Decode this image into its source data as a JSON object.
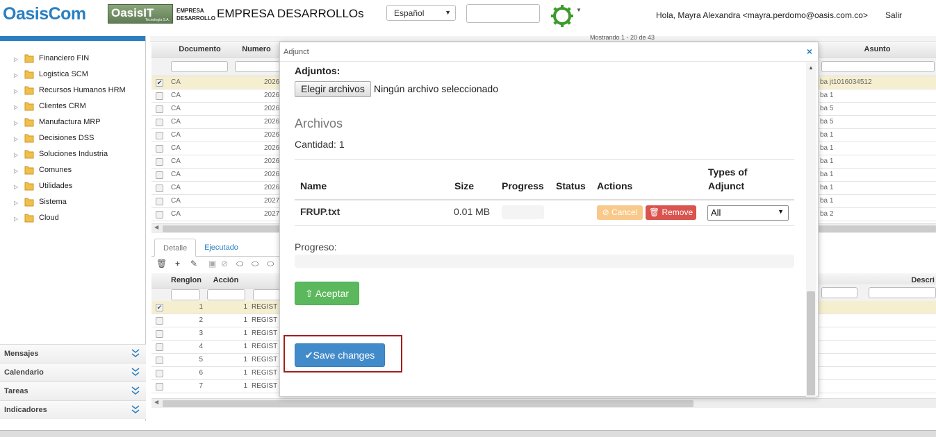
{
  "header": {
    "logo_main": "OasisCom",
    "logo_secondary": "OasisIT",
    "logo_secondary_tag": "Tecnología S.A.",
    "company_small_line1": "EMPRESA",
    "company_small_line2": "DESARROLLO",
    "company_title": "EMPRESA DESARROLLOs",
    "language_selected": "Español",
    "greeting": "Hola, Mayra Alexandra <mayra.perdomo@oasis.com.co>",
    "logout_label": "Salir"
  },
  "sidebar": {
    "items": [
      {
        "label": "Financiero FIN"
      },
      {
        "label": "Logistica SCM"
      },
      {
        "label": "Recursos Humanos HRM"
      },
      {
        "label": "Clientes CRM"
      },
      {
        "label": "Manufactura MRP"
      },
      {
        "label": "Decisiones DSS"
      },
      {
        "label": "Soluciones Industria"
      },
      {
        "label": "Comunes"
      },
      {
        "label": "Utilidades"
      },
      {
        "label": "Sistema"
      },
      {
        "label": "Cloud"
      }
    ],
    "panels": [
      {
        "label": "Mensajes"
      },
      {
        "label": "Calendario"
      },
      {
        "label": "Tareas"
      },
      {
        "label": "Indicadores"
      }
    ]
  },
  "grid": {
    "showing": "Mostrando 1 - 20 de 43",
    "columns": [
      "Documento",
      "Numero",
      "Asunto"
    ],
    "rows": [
      {
        "doc": "CA",
        "num": "2026",
        "asunto": "ba jt1016034512"
      },
      {
        "doc": "CA",
        "num": "2026",
        "asunto": "ba 1"
      },
      {
        "doc": "CA",
        "num": "2026",
        "asunto": "ba 5"
      },
      {
        "doc": "CA",
        "num": "2026",
        "asunto": "ba 5"
      },
      {
        "doc": "CA",
        "num": "2026",
        "asunto": "ba 1"
      },
      {
        "doc": "CA",
        "num": "2026",
        "asunto": "ba 1"
      },
      {
        "doc": "CA",
        "num": "2026",
        "asunto": "ba 1"
      },
      {
        "doc": "CA",
        "num": "2026",
        "asunto": "ba 1"
      },
      {
        "doc": "CA",
        "num": "2026",
        "asunto": "ba 1"
      },
      {
        "doc": "CA",
        "num": "2027",
        "asunto": "ba 1"
      },
      {
        "doc": "CA",
        "num": "2027",
        "asunto": "ba 2"
      }
    ]
  },
  "detail": {
    "tab_detalle": "Detalle",
    "tab_ejecutado": "Ejecutado",
    "columns": [
      "Renglon",
      "Acción",
      "Descri"
    ],
    "rows": [
      {
        "renglon": "1",
        "accion": "1",
        "rest": "REGIST"
      },
      {
        "renglon": "2",
        "accion": "1",
        "rest": "REGIST"
      },
      {
        "renglon": "3",
        "accion": "1",
        "rest": "REGIST"
      },
      {
        "renglon": "4",
        "accion": "1",
        "rest": "REGIST"
      },
      {
        "renglon": "5",
        "accion": "1",
        "rest": "REGIST"
      },
      {
        "renglon": "6",
        "accion": "1",
        "rest": "REGIST"
      },
      {
        "renglon": "7",
        "accion": "1",
        "rest": "REGIST"
      }
    ]
  },
  "modal": {
    "title": "Adjunct",
    "attachments_label": "Adjuntos:",
    "choose_files": "Elegir archivos",
    "no_file": "Ningún archivo seleccionado",
    "files_heading": "Archivos",
    "quantity": "Cantidad: 1",
    "table_headers": {
      "name": "Name",
      "size": "Size",
      "progress": "Progress",
      "status": "Status",
      "actions": "Actions",
      "types_line1": "Types of",
      "types_line2": "Adjunct"
    },
    "file": {
      "name": "FRUP.txt",
      "size": "0.01 MB",
      "cancel": "Cancel",
      "remove": "Remove",
      "type": "All"
    },
    "progress_label": "Progreso:",
    "accept": "Aceptar",
    "save": "Save changes"
  },
  "colors": {
    "brand_blue": "#2a7fc1",
    "accept_green": "#5cb85c",
    "save_blue": "#428bca",
    "remove_red": "#d9534f",
    "cancel_orange": "#f8c98a",
    "highlight_red": "#a21c1c"
  }
}
